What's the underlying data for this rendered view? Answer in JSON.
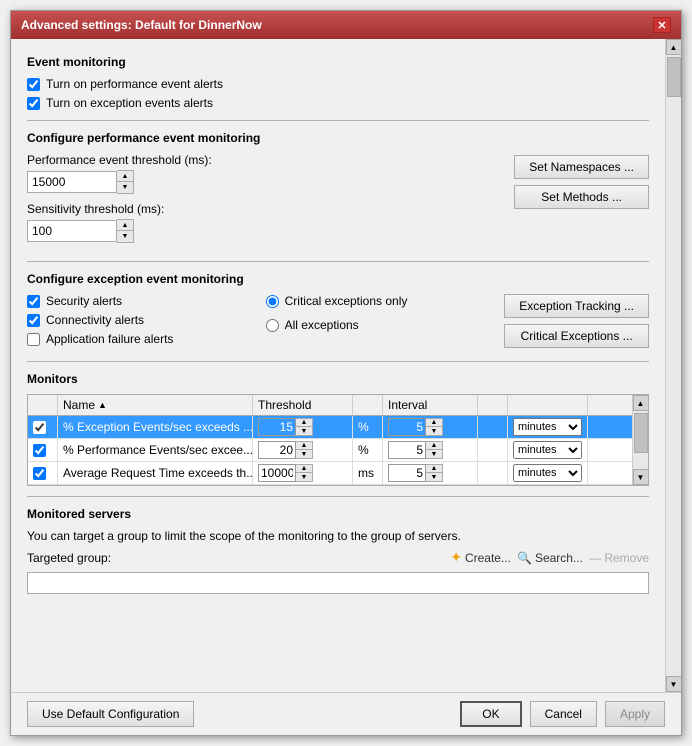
{
  "title_bar": {
    "title": "Advanced settings: Default for DinnerNow",
    "close_label": "✕"
  },
  "event_monitoring": {
    "section_title": "Event monitoring",
    "check1_label": "Turn on performance event alerts",
    "check2_label": "Turn on exception events alerts"
  },
  "perf_section": {
    "section_title": "Configure performance event monitoring",
    "threshold_label": "Performance event threshold (ms):",
    "threshold_value": "15000",
    "sensitivity_label": "Sensitivity threshold (ms):",
    "sensitivity_value": "100",
    "btn_namespaces": "Set Namespaces ...",
    "btn_methods": "Set Methods ..."
  },
  "exception_section": {
    "section_title": "Configure exception event monitoring",
    "check_security": "Security alerts",
    "check_connectivity": "Connectivity alerts",
    "check_app_failure": "Application failure alerts",
    "radio_critical": "Critical exceptions only",
    "radio_all": "All exceptions",
    "btn_exception_tracking": "Exception Tracking ...",
    "btn_critical_exceptions": "Critical Exceptions ..."
  },
  "monitors": {
    "section_title": "Monitors",
    "header_name": "Name",
    "header_threshold": "Threshold",
    "header_interval": "Interval",
    "rows": [
      {
        "checked": true,
        "name": "% Exception Events/sec exceeds ...",
        "threshold_value": "15",
        "threshold_unit": "%",
        "interval_value": "5",
        "interval_unit": "minutes",
        "selected": true
      },
      {
        "checked": true,
        "name": "% Performance Events/sec excee...",
        "threshold_value": "20",
        "threshold_unit": "%",
        "interval_value": "5",
        "interval_unit": "minutes",
        "selected": false
      },
      {
        "checked": true,
        "name": "Average Request Time exceeds th...",
        "threshold_value": "10000",
        "threshold_unit": "ms",
        "interval_value": "5",
        "interval_unit": "minutes",
        "selected": false
      }
    ]
  },
  "monitored_servers": {
    "section_title": "Monitored servers",
    "description": "You can target a group to limit the scope of the monitoring to the group of servers.",
    "targeted_group_label": "Targeted group:",
    "create_label": "Create...",
    "search_label": "Search...",
    "remove_label": "Remove"
  },
  "footer": {
    "use_default_label": "Use Default Configuration",
    "ok_label": "OK",
    "cancel_label": "Cancel",
    "apply_label": "Apply"
  }
}
